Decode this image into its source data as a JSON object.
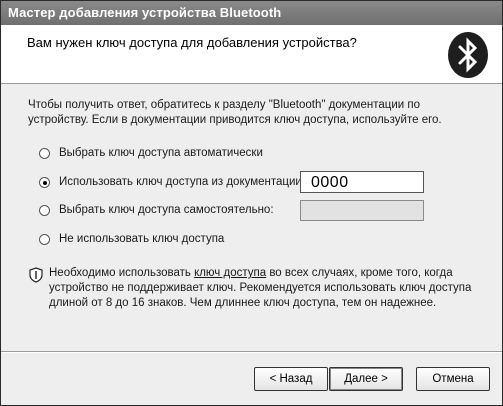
{
  "window": {
    "title": "Мастер добавления устройства Bluetooth"
  },
  "header": {
    "heading": "Вам нужен ключ доступа для добавления устройства?",
    "logo_icon": "bluetooth-icon"
  },
  "description": "Чтобы получить ответ, обратитесь к разделу \"Bluetooth\" документации по устройству. Если в документации приводится ключ доступа, используйте его.",
  "options": [
    {
      "label": "Выбрать ключ доступа автоматически",
      "checked": false
    },
    {
      "label": "Использовать ключ доступа из документации:",
      "checked": true
    },
    {
      "label": "Выбрать ключ доступа самостоятельно:",
      "checked": false
    },
    {
      "label": "Не использовать ключ доступа",
      "checked": false
    }
  ],
  "passkey_value": "0000",
  "custom_passkey_value": "",
  "note": {
    "icon": "shield-icon",
    "prefix": "Необходимо использовать ",
    "link": "ключ доступа",
    "suffix": " во всех случаях, кроме того, когда устройство не поддерживает ключ. Рекомендуется использовать ключ доступа длиной от 8 до 16 знаков. Чем длиннее ключ доступа, тем он надежнее."
  },
  "buttons": {
    "back": "< Назад",
    "next": "Далее >",
    "cancel": "Отмена"
  }
}
